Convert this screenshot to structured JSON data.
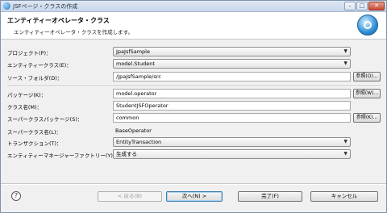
{
  "window": {
    "title": "JSFページ・クラスの作成",
    "buttons": {
      "minimize": "–",
      "maximize": "□",
      "close": "✕"
    }
  },
  "header": {
    "title": "エンティティーオペレータ・クラス",
    "description": "エンティティーオペレータ・クラスを作成します。"
  },
  "form": {
    "project": {
      "label": "プロジェクト(P)：",
      "value": "JpaJsfSample"
    },
    "entity_class": {
      "label": "エンティティークラス(E)：",
      "value": "model.Student"
    },
    "source_folder": {
      "label": "ソース・フォルダ(D)：",
      "value": "/JpaJsfSample/src",
      "browse": "参照(O)..."
    },
    "package": {
      "label": "パッケージ(K)：",
      "value": "model.operator",
      "browse": "参照(W)..."
    },
    "class_name": {
      "label": "クラス名(M)：",
      "value": "StudentJSFOperator"
    },
    "super_package": {
      "label": "スーパークラスパッケージ(S)：",
      "value": "common",
      "browse": "参照(K)..."
    },
    "super_class": {
      "label": "スーパークラス名(L)：",
      "value": "BaseOperator"
    },
    "transaction": {
      "label": "トランザクション(T)：",
      "value": "EntityTransaction"
    },
    "manager_factory": {
      "label": "エンティティーマネージャーファクトリー(Y)：",
      "value": "生成する"
    }
  },
  "footer": {
    "help": "?",
    "back": "< 戻る(B)",
    "next": "次へ(N) >",
    "finish": "完了(F)",
    "cancel": "キャンセル"
  }
}
